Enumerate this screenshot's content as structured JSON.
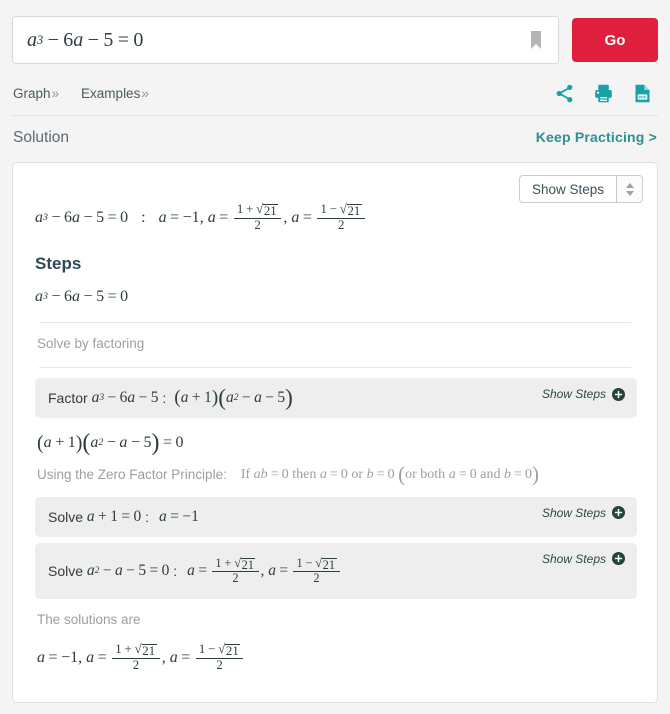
{
  "search": {
    "expression": "a^3 - 6a - 5 = 0",
    "bookmark_icon": "bookmark-icon",
    "go_label": "Go",
    "go_color": "#e01f3d"
  },
  "nav": {
    "links": [
      {
        "label": "Graph",
        "chevron": "»"
      },
      {
        "label": "Examples",
        "chevron": "»"
      }
    ],
    "icons": [
      {
        "name": "share-icon"
      },
      {
        "name": "print-icon"
      },
      {
        "name": "pdf-icon"
      }
    ],
    "icon_color": "#17a2a8"
  },
  "solution_header": {
    "title": "Solution",
    "keep_practicing": "Keep Practicing >",
    "link_color": "#2e8f93"
  },
  "card": {
    "show_steps_select": {
      "label": "Show Steps",
      "up_arrow": "▲",
      "down_arrow": "▼"
    },
    "main_result": {
      "lhs": "a^3 - 6a - 5 = 0",
      "separator": ":",
      "roots": "a = -1, a = (1 + sqrt(21))/2, a = (1 - sqrt(21))/2"
    },
    "steps_heading": "Steps",
    "equation": "a^3 - 6a - 5 = 0",
    "method_note": "Solve by factoring",
    "factor_step": {
      "prefix": "Factor",
      "expression": "a^3 - 6a - 5",
      "colon": ":",
      "result": "(a + 1)(a^2 - a - 5)",
      "show_steps": "Show Steps",
      "plus_icon": "plus-circle-icon"
    },
    "factored_equation": "(a + 1)(a^2 - a - 5) = 0",
    "zero_factor_note": {
      "label": "Using the Zero Factor Principle:",
      "statement": "If ab = 0 then a = 0 or b = 0 (or both a = 0 and b = 0)"
    },
    "solve_step_1": {
      "prefix": "Solve",
      "equation": "a + 1 = 0",
      "colon": ":",
      "result": "a = -1",
      "show_steps": "Show Steps",
      "plus_icon": "plus-circle-icon"
    },
    "solve_step_2": {
      "prefix": "Solve",
      "equation": "a^2 - a - 5 = 0",
      "colon": ":",
      "result": "a = (1 + sqrt(21))/2, a = (1 - sqrt(21))/2",
      "show_steps": "Show Steps",
      "plus_icon": "plus-circle-icon"
    },
    "solutions_label": "The solutions are",
    "solutions": "a = -1, a = (1 + sqrt(21))/2, a = (1 - sqrt(21))/2",
    "literals": {
      "a": "a",
      "b": "b",
      "minus": "−",
      "plus": "+",
      "equals": "=",
      "zero": "0",
      "one": "1",
      "two": "2",
      "three": "3",
      "five": "5",
      "six": "6",
      "twentyone": "21",
      "radical": "√",
      "lparen": "(",
      "rparen": ")",
      "comma": ",",
      "colon": ":",
      "neg_one": "−1",
      "if": "If",
      "then": "then",
      "or": "or",
      "or_both": "or both",
      "and": "and"
    }
  }
}
